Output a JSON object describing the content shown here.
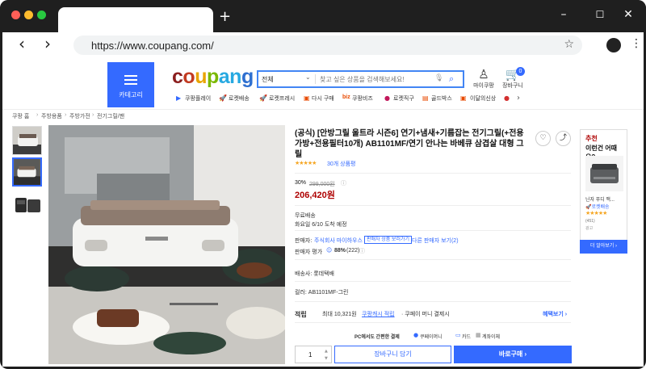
{
  "browser": {
    "url": "https://www.coupang.com/",
    "new_tab_glyph": "+",
    "back_glyph": "‹",
    "forward_glyph": "›",
    "minimize_glyph": "–",
    "maximize_glyph": "☐",
    "close_glyph": "✕",
    "star_glyph": "☆",
    "menu_glyph": "⋮"
  },
  "header": {
    "category_label": "카테고리",
    "logo_letters": [
      "c",
      "o",
      "u",
      "p",
      "a",
      "n",
      "g"
    ],
    "logo_colors": [
      "#8b1e1e",
      "#c23b22",
      "#e8a400",
      "#7ab800",
      "#27a9e1",
      "#27a9e1",
      "#2e6fd0"
    ],
    "search_select": "전체",
    "search_caret": "⌄",
    "search_placeholder": "찾고 싶은 상품을 검색해보세요!",
    "mic_glyph": "🎙",
    "search_glyph": "⌕",
    "mypage_label": "마이쿠팡",
    "mypage_glyph": "♙",
    "cart_label": "장바구니",
    "cart_glyph": "🛒",
    "cart_count": "0"
  },
  "subnav": {
    "items": [
      {
        "icon": "▶",
        "label": "쿠팡플레이"
      },
      {
        "icon": "🚀",
        "label": "로켓배송"
      },
      {
        "icon": "🚀",
        "label": "로켓프레시"
      },
      {
        "icon": "▣",
        "label": "다시 구매"
      },
      {
        "icon": "biz",
        "label": "쿠팡비즈"
      },
      {
        "icon": "●",
        "label": "로켓직구"
      },
      {
        "icon": "▤",
        "label": "골드박스"
      },
      {
        "icon": "▣",
        "label": "이달의신상"
      },
      {
        "icon": "●",
        "label": ""
      }
    ],
    "next_glyph": "›"
  },
  "breadcrumb": [
    "쿠팡 홈",
    "주방용품",
    "주방가전",
    "전기그릴/팬"
  ],
  "breadcrumb_sep": "›",
  "product": {
    "title": "(공식) [안방그릴 울트라 시즌6] 연기+냄새+기름잡는 전기그릴(+전용가방+전용필터10개) AB1101MF/연기 안나는 바베큐 삼겹살 대형 그릴",
    "like_glyph": "♡",
    "share_glyph": "⤴",
    "rating_stars": "★★★★★",
    "rating": 4.5,
    "review_count": "30개 상품평",
    "discount": "30%",
    "original_price": "299,000원",
    "info_glyph": "ⓘ",
    "price": "206,420원",
    "shipping_label": "무료배송",
    "delivery": "화요일 6/10 도착 예정",
    "seller_label": "판매자:",
    "seller_name": "주식회사 마이하우스",
    "seller_other_products": "판매자 상품 보러가기",
    "other_sellers": "다른 판매자 보기(2)",
    "seller_rating_label": "판매자 평가",
    "seller_rating_glyph": "☺",
    "seller_rating_value": "88%",
    "seller_rating_count": "(222)",
    "carrier": "배송사: 롯데택배",
    "color": "컬러: AB1101MF-그린",
    "benefit_label": "적립",
    "benefit_text_pre": "최대 10,321원",
    "benefit_text_link": "쿠팡캐시 적립",
    "benefit_text_post": "· 쿠페이 머니 결제시",
    "benefit_more": "혜택보기 ›",
    "pay_label": "PC에서도 간편한 결제",
    "pay_options": [
      "쿠페이머니",
      "카드",
      "계좌이체"
    ],
    "quantity": "1",
    "qty_up": "▲",
    "qty_down": "▼",
    "add_to_cart": "장바구니 담기",
    "buy_now": "바로구매 ›"
  },
  "recommend": {
    "line1": "추천",
    "line2": "이런건 어때요?",
    "name": "닌자 푸디 맥...",
    "badge": "🚀로켓배송",
    "stars": "★★★★★",
    "count": "(451)",
    "ad": "광고",
    "more": "더 알아보기 ›"
  }
}
